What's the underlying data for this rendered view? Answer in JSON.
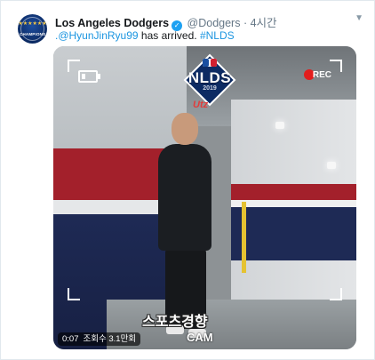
{
  "tweet": {
    "account_name": "Los Angeles Dodgers",
    "handle": "@Dodgers",
    "separator": "·",
    "time": "4시간",
    "avatar_badge": "CHAMPIONS",
    "text_mention": ".@HyunJinRyu99",
    "text_body": " has arrived. ",
    "text_hashtag": "#NLDS"
  },
  "media": {
    "overlay_logo": "NLDS",
    "overlay_year": "2019",
    "sponsor": "Utz",
    "rec_label": "REC",
    "caption": "스포츠경향",
    "cam_label": "CAM",
    "duration": "0:07",
    "view_count": "조회수 3.1만회"
  },
  "colors": {
    "link": "#1b95e0",
    "verified": "#1da1f2",
    "rec": "#e21d1d"
  },
  "icons": [
    "verified-icon",
    "chevron-down-icon",
    "battery-icon",
    "rec-dot-icon",
    "mlb-logo-icon"
  ]
}
